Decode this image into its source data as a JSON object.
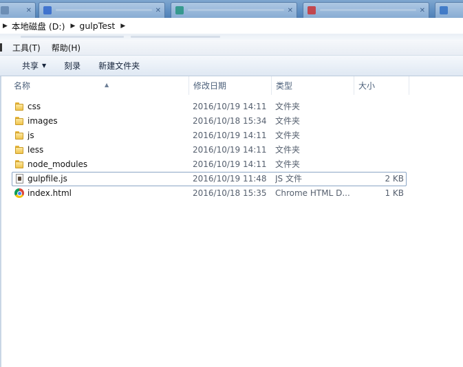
{
  "breadcrumb": {
    "items": [
      "本地磁盘 (D:)",
      "gulpTest"
    ]
  },
  "menu": {
    "items": [
      "工具(T)",
      "帮助(H)"
    ]
  },
  "toolbar": {
    "share_label": "共享",
    "burn_label": "刻录",
    "new_folder_label": "新建文件夹"
  },
  "columns": {
    "name": "名称",
    "date": "修改日期",
    "type": "类型",
    "size": "大小"
  },
  "files": [
    {
      "name": "css",
      "date": "2016/10/19 14:11",
      "type": "文件夹",
      "size": "",
      "icon": "folder-icon"
    },
    {
      "name": "images",
      "date": "2016/10/18 15:34",
      "type": "文件夹",
      "size": "",
      "icon": "folder-icon"
    },
    {
      "name": "js",
      "date": "2016/10/19 14:11",
      "type": "文件夹",
      "size": "",
      "icon": "folder-icon"
    },
    {
      "name": "less",
      "date": "2016/10/19 14:11",
      "type": "文件夹",
      "size": "",
      "icon": "folder-icon"
    },
    {
      "name": "node_modules",
      "date": "2016/10/19 14:11",
      "type": "文件夹",
      "size": "",
      "icon": "folder-icon"
    },
    {
      "name": "gulpfile.js",
      "date": "2016/10/19 11:48",
      "type": "JS 文件",
      "size": "2 KB",
      "icon": "js-file-icon"
    },
    {
      "name": "index.html",
      "date": "2016/10/18 15:35",
      "type": "Chrome HTML D...",
      "size": "1 KB",
      "icon": "chrome-html-icon"
    }
  ]
}
